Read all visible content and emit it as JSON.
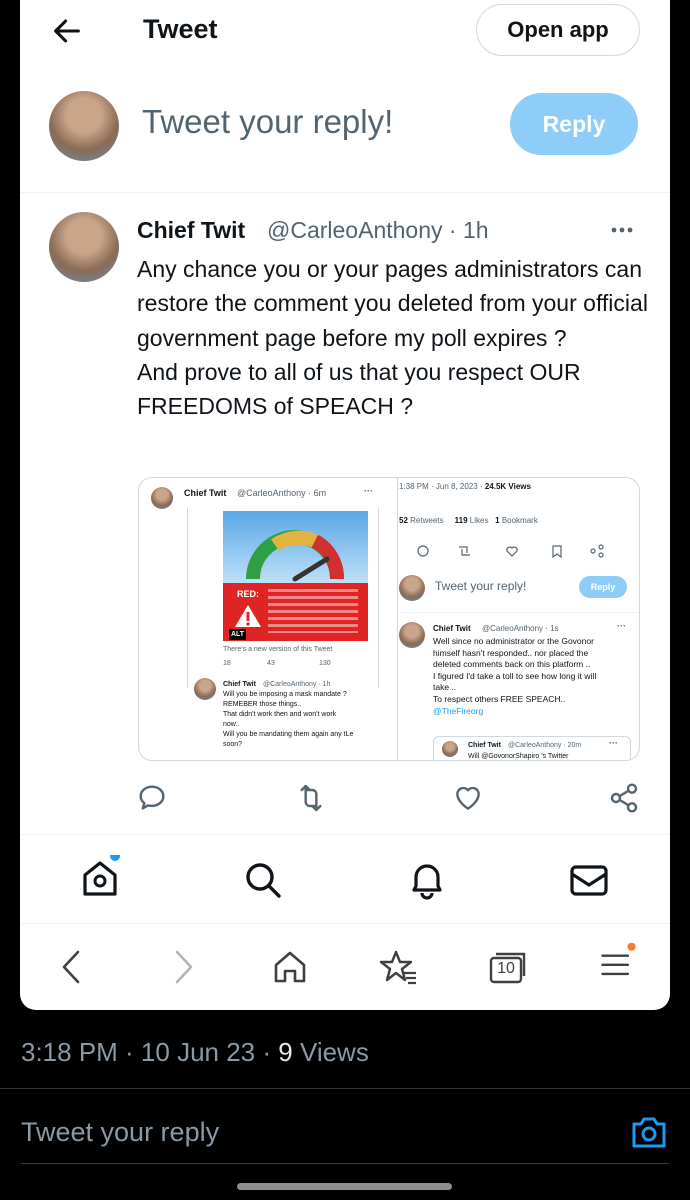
{
  "header": {
    "title": "Tweet",
    "open_app_label": "Open app"
  },
  "compose": {
    "placeholder": "Tweet your reply!",
    "reply_label": "Reply"
  },
  "tweet": {
    "display_name": "Chief Twit",
    "handle": "@CarleoAnthony",
    "time": "1h",
    "meta": "@CarleoAnthony · 1h",
    "text_lines": [
      "Any chance you or your pages administrators can restore the comment you deleted from your official government page before my poll expires ?",
      "And prove to all of us that you respect OUR FREEDOMS of SPEACH ?"
    ]
  },
  "embedded_screenshot": {
    "left": {
      "header_name": "Chief Twit",
      "header_meta": "@CarleoAnthony · 6m",
      "alert_label": "RED:",
      "alt_badge": "ALT",
      "new_version": "There's a new version of this Tweet",
      "stats": [
        "18",
        "43",
        "130"
      ],
      "reply_name": "Chief Twit",
      "reply_meta": "@CarleoAnthony · 1h",
      "reply_lines": [
        "Will you be imposing a mask mandate ?",
        "REMEBER those things..",
        "That didn't work then and won't work",
        "now..",
        "Will you be mandating them again any tLe",
        "soon?"
      ]
    },
    "right": {
      "timestamp": "1:38 PM · Jun 8, 2023 · ",
      "views": "24.5K Views",
      "retweets_count": "52",
      "retweets_label": "Retweets",
      "likes_count": "119",
      "likes_label": "Likes",
      "bookmarks_count": "1",
      "bookmarks_label": "Bookmark",
      "reply_placeholder": "Tweet your reply!",
      "reply_button": "Reply",
      "reply_name": "Chief Twit",
      "reply_meta": "@CarleoAnthony · 1s",
      "reply_lines": [
        "Well since no administrator or the Govonor",
        "himself hasn't responded.. nor placed the",
        "deleted comments back on this platform ..",
        "I figured I'd take a toll to see how long it will",
        "take ..",
        "To respect others FREE SPEACH.."
      ],
      "mention": "@TheFireorg",
      "quote_name": "Chief Twit",
      "quote_meta": "@CarleoAnthony · 20m",
      "quote_text": "Will @GovonorShapiro 's Twitter"
    }
  },
  "tab_badge": "10",
  "footer": {
    "time_date": "3:18 PM · 10 Jun 23 · ",
    "views_count": "9",
    "views_label": " Views",
    "reply_placeholder": "Tweet your reply"
  },
  "colors": {
    "accent": "#1d9bf0",
    "reply_button": "#8ecdf8",
    "notification_dot": "#f4802b"
  }
}
